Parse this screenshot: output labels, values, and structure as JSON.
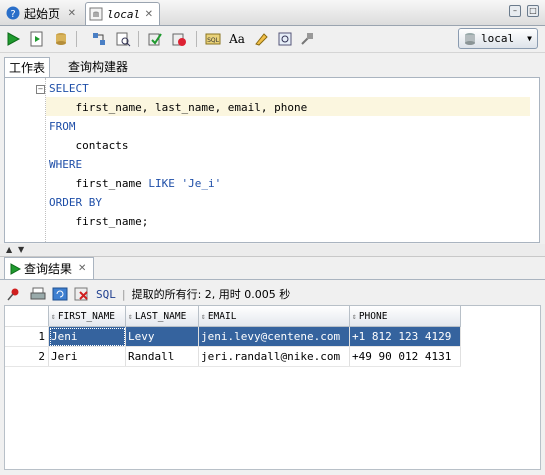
{
  "tabs": [
    {
      "label": "起始页",
      "icon": "help-icon"
    },
    {
      "label": "local",
      "icon": "sql-worksheet-icon"
    }
  ],
  "toolbar": {
    "buttons": [
      "run-statement-icon",
      "run-script-icon",
      "commit-icon",
      "rollback-icon",
      "explain-plan-icon",
      "autotrace-icon",
      "sql-history-icon",
      "sql-tuning-icon",
      "unshared-sql-icon",
      "to-upper-lower-icon",
      "clear-icon",
      "find-icon",
      "format-icon"
    ],
    "connection": "local"
  },
  "subtabs": [
    "工作表",
    "查询构建器"
  ],
  "editor": {
    "lines": [
      {
        "kw": "SELECT",
        "text": ""
      },
      {
        "kw": "",
        "text": "    first_name, last_name, email, phone"
      },
      {
        "kw": "FROM",
        "text": ""
      },
      {
        "kw": "",
        "text": "    contacts"
      },
      {
        "kw": "WHERE",
        "text": ""
      },
      {
        "kw": "",
        "text": "    first_name ",
        "kw2": "LIKE",
        "str": "'Je_i'"
      },
      {
        "kw": "ORDER BY",
        "text": ""
      },
      {
        "kw": "",
        "text": "    first_name;"
      }
    ]
  },
  "results": {
    "tab_label": "查询结果",
    "sql_label": "SQL",
    "fetch_message": "提取的所有行: 2, 用时 0.005 秒",
    "columns": [
      "FIRST_NAME",
      "LAST_NAME",
      "EMAIL",
      "PHONE"
    ],
    "rows": [
      {
        "n": "1",
        "cells": [
          "Jeni",
          "Levy",
          "jeni.levy@centene.com",
          "+1 812 123 4129"
        ]
      },
      {
        "n": "2",
        "cells": [
          "Jeri",
          "Randall",
          "jeri.randall@nike.com",
          "+49 90 012 4131"
        ]
      }
    ]
  }
}
